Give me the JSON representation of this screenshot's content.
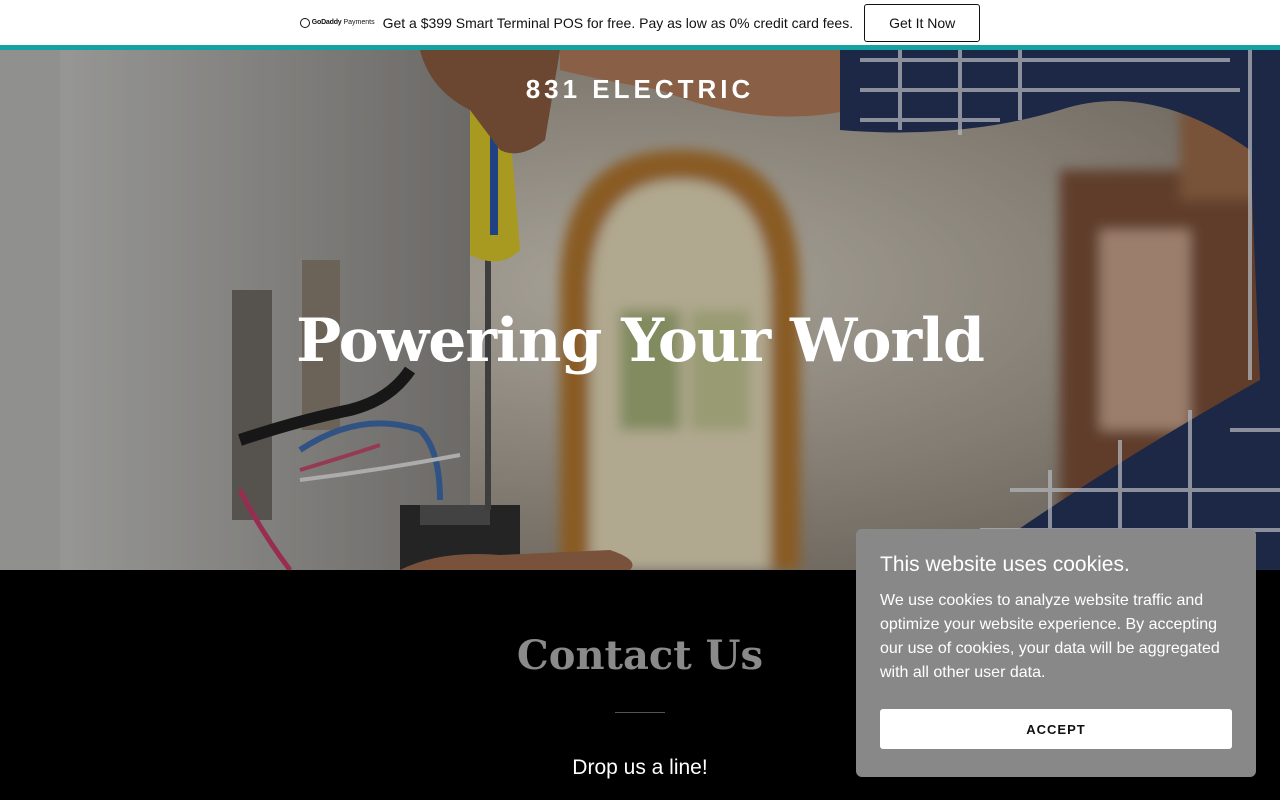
{
  "promo": {
    "logo_brand": "GoDaddy",
    "logo_sub": "Payments",
    "text": "Get a $399 Smart Terminal POS for free. Pay as low as 0% credit card fees.",
    "button_label": "Get It Now",
    "accent_color": "#14a2a2"
  },
  "hero": {
    "site_title": "831 ELECTRIC",
    "heading": "Powering Your World"
  },
  "contact": {
    "title": "Contact Us",
    "subtitle": "Drop us a line!"
  },
  "cookie": {
    "title": "This website uses cookies.",
    "body": "We use cookies to analyze website traffic and optimize your website experience. By accepting our use of cookies, your data will be aggregated with all other user data.",
    "accept_label": "ACCEPT"
  }
}
